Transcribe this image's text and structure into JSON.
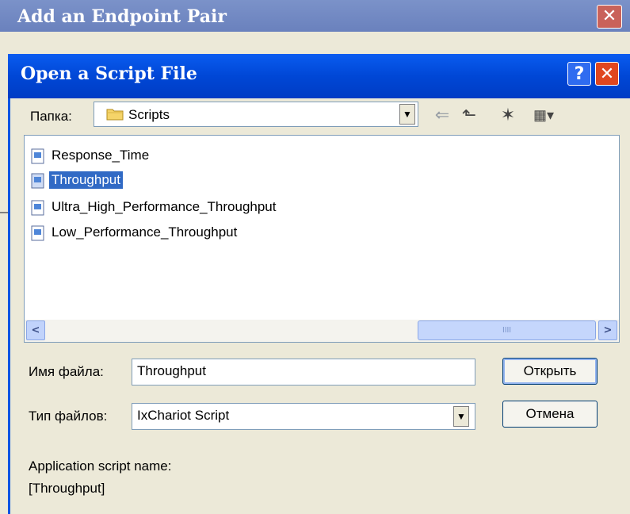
{
  "parent_window": {
    "title": "Add an Endpoint Pair",
    "close_glyph": "✕"
  },
  "dialog": {
    "title": "Open a Script File",
    "help_glyph": "?",
    "close_glyph": "✕",
    "folder_label": "Папка:",
    "folder_value": "Scripts",
    "toolbar": {
      "back_icon": "⇐",
      "up_icon": "⬑",
      "new_folder_icon": "✶",
      "view_icon": "▦▾"
    },
    "files": [
      {
        "name": "Response_Time",
        "selected": false
      },
      {
        "name": "Throughput",
        "selected": true
      },
      {
        "name": "Ultra_High_Performance_Throughput",
        "selected": false
      },
      {
        "name": "Low_Performance_Throughput",
        "selected": false
      }
    ],
    "scroll": {
      "left": "<",
      "right": ">",
      "thumb_grip": "IIII"
    },
    "filename_label": "Имя файла:",
    "filename_value": "Throughput",
    "filetype_label": "Тип файлов:",
    "filetype_value": "IxChariot Script",
    "open_button": "Открыть",
    "cancel_button": "Отмена",
    "app_script_label": "Application script name:",
    "app_script_value": "[Throughput]"
  },
  "colors": {
    "title_blue": "#0047d6",
    "selection": "#316ac5",
    "face": "#ece9d8"
  }
}
